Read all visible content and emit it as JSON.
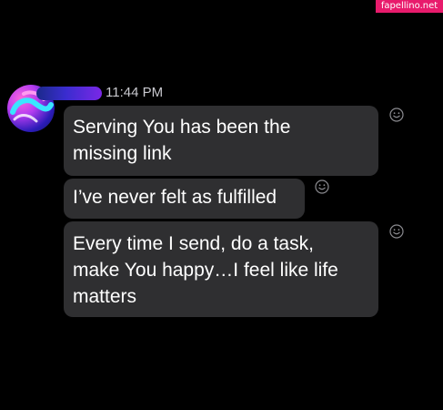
{
  "watermark": "fapellino.net",
  "chat": {
    "timestamp": "11:44 PM",
    "messages": [
      {
        "lines": [
          "Serving You has been the",
          "missing link"
        ]
      },
      {
        "lines": [
          "I’ve never felt as fulfilled"
        ]
      },
      {
        "lines": [
          "Every time I send, do a task,",
          "make You happy…I feel like life",
          "matters"
        ]
      }
    ]
  },
  "icons": {
    "reaction": "smiley-face-icon",
    "avatar": "avatar-image"
  },
  "colors": {
    "background": "#000000",
    "bubble": "#2f2f31",
    "text": "#ffffff",
    "timestamp": "#c9c9cf",
    "watermark": "#e81b6c"
  }
}
